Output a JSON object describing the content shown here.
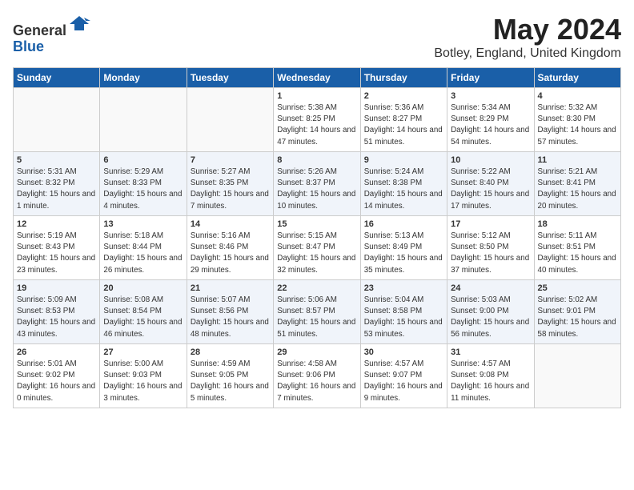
{
  "header": {
    "logo_line1": "General",
    "logo_line2": "Blue",
    "month": "May 2024",
    "location": "Botley, England, United Kingdom"
  },
  "weekdays": [
    "Sunday",
    "Monday",
    "Tuesday",
    "Wednesday",
    "Thursday",
    "Friday",
    "Saturday"
  ],
  "weeks": [
    [
      {
        "day": "",
        "sunrise": "",
        "sunset": "",
        "daylight": ""
      },
      {
        "day": "",
        "sunrise": "",
        "sunset": "",
        "daylight": ""
      },
      {
        "day": "",
        "sunrise": "",
        "sunset": "",
        "daylight": ""
      },
      {
        "day": "1",
        "sunrise": "Sunrise: 5:38 AM",
        "sunset": "Sunset: 8:25 PM",
        "daylight": "Daylight: 14 hours and 47 minutes."
      },
      {
        "day": "2",
        "sunrise": "Sunrise: 5:36 AM",
        "sunset": "Sunset: 8:27 PM",
        "daylight": "Daylight: 14 hours and 51 minutes."
      },
      {
        "day": "3",
        "sunrise": "Sunrise: 5:34 AM",
        "sunset": "Sunset: 8:29 PM",
        "daylight": "Daylight: 14 hours and 54 minutes."
      },
      {
        "day": "4",
        "sunrise": "Sunrise: 5:32 AM",
        "sunset": "Sunset: 8:30 PM",
        "daylight": "Daylight: 14 hours and 57 minutes."
      }
    ],
    [
      {
        "day": "5",
        "sunrise": "Sunrise: 5:31 AM",
        "sunset": "Sunset: 8:32 PM",
        "daylight": "Daylight: 15 hours and 1 minute."
      },
      {
        "day": "6",
        "sunrise": "Sunrise: 5:29 AM",
        "sunset": "Sunset: 8:33 PM",
        "daylight": "Daylight: 15 hours and 4 minutes."
      },
      {
        "day": "7",
        "sunrise": "Sunrise: 5:27 AM",
        "sunset": "Sunset: 8:35 PM",
        "daylight": "Daylight: 15 hours and 7 minutes."
      },
      {
        "day": "8",
        "sunrise": "Sunrise: 5:26 AM",
        "sunset": "Sunset: 8:37 PM",
        "daylight": "Daylight: 15 hours and 10 minutes."
      },
      {
        "day": "9",
        "sunrise": "Sunrise: 5:24 AM",
        "sunset": "Sunset: 8:38 PM",
        "daylight": "Daylight: 15 hours and 14 minutes."
      },
      {
        "day": "10",
        "sunrise": "Sunrise: 5:22 AM",
        "sunset": "Sunset: 8:40 PM",
        "daylight": "Daylight: 15 hours and 17 minutes."
      },
      {
        "day": "11",
        "sunrise": "Sunrise: 5:21 AM",
        "sunset": "Sunset: 8:41 PM",
        "daylight": "Daylight: 15 hours and 20 minutes."
      }
    ],
    [
      {
        "day": "12",
        "sunrise": "Sunrise: 5:19 AM",
        "sunset": "Sunset: 8:43 PM",
        "daylight": "Daylight: 15 hours and 23 minutes."
      },
      {
        "day": "13",
        "sunrise": "Sunrise: 5:18 AM",
        "sunset": "Sunset: 8:44 PM",
        "daylight": "Daylight: 15 hours and 26 minutes."
      },
      {
        "day": "14",
        "sunrise": "Sunrise: 5:16 AM",
        "sunset": "Sunset: 8:46 PM",
        "daylight": "Daylight: 15 hours and 29 minutes."
      },
      {
        "day": "15",
        "sunrise": "Sunrise: 5:15 AM",
        "sunset": "Sunset: 8:47 PM",
        "daylight": "Daylight: 15 hours and 32 minutes."
      },
      {
        "day": "16",
        "sunrise": "Sunrise: 5:13 AM",
        "sunset": "Sunset: 8:49 PM",
        "daylight": "Daylight: 15 hours and 35 minutes."
      },
      {
        "day": "17",
        "sunrise": "Sunrise: 5:12 AM",
        "sunset": "Sunset: 8:50 PM",
        "daylight": "Daylight: 15 hours and 37 minutes."
      },
      {
        "day": "18",
        "sunrise": "Sunrise: 5:11 AM",
        "sunset": "Sunset: 8:51 PM",
        "daylight": "Daylight: 15 hours and 40 minutes."
      }
    ],
    [
      {
        "day": "19",
        "sunrise": "Sunrise: 5:09 AM",
        "sunset": "Sunset: 8:53 PM",
        "daylight": "Daylight: 15 hours and 43 minutes."
      },
      {
        "day": "20",
        "sunrise": "Sunrise: 5:08 AM",
        "sunset": "Sunset: 8:54 PM",
        "daylight": "Daylight: 15 hours and 46 minutes."
      },
      {
        "day": "21",
        "sunrise": "Sunrise: 5:07 AM",
        "sunset": "Sunset: 8:56 PM",
        "daylight": "Daylight: 15 hours and 48 minutes."
      },
      {
        "day": "22",
        "sunrise": "Sunrise: 5:06 AM",
        "sunset": "Sunset: 8:57 PM",
        "daylight": "Daylight: 15 hours and 51 minutes."
      },
      {
        "day": "23",
        "sunrise": "Sunrise: 5:04 AM",
        "sunset": "Sunset: 8:58 PM",
        "daylight": "Daylight: 15 hours and 53 minutes."
      },
      {
        "day": "24",
        "sunrise": "Sunrise: 5:03 AM",
        "sunset": "Sunset: 9:00 PM",
        "daylight": "Daylight: 15 hours and 56 minutes."
      },
      {
        "day": "25",
        "sunrise": "Sunrise: 5:02 AM",
        "sunset": "Sunset: 9:01 PM",
        "daylight": "Daylight: 15 hours and 58 minutes."
      }
    ],
    [
      {
        "day": "26",
        "sunrise": "Sunrise: 5:01 AM",
        "sunset": "Sunset: 9:02 PM",
        "daylight": "Daylight: 16 hours and 0 minutes."
      },
      {
        "day": "27",
        "sunrise": "Sunrise: 5:00 AM",
        "sunset": "Sunset: 9:03 PM",
        "daylight": "Daylight: 16 hours and 3 minutes."
      },
      {
        "day": "28",
        "sunrise": "Sunrise: 4:59 AM",
        "sunset": "Sunset: 9:05 PM",
        "daylight": "Daylight: 16 hours and 5 minutes."
      },
      {
        "day": "29",
        "sunrise": "Sunrise: 4:58 AM",
        "sunset": "Sunset: 9:06 PM",
        "daylight": "Daylight: 16 hours and 7 minutes."
      },
      {
        "day": "30",
        "sunrise": "Sunrise: 4:57 AM",
        "sunset": "Sunset: 9:07 PM",
        "daylight": "Daylight: 16 hours and 9 minutes."
      },
      {
        "day": "31",
        "sunrise": "Sunrise: 4:57 AM",
        "sunset": "Sunset: 9:08 PM",
        "daylight": "Daylight: 16 hours and 11 minutes."
      },
      {
        "day": "",
        "sunrise": "",
        "sunset": "",
        "daylight": ""
      }
    ]
  ]
}
